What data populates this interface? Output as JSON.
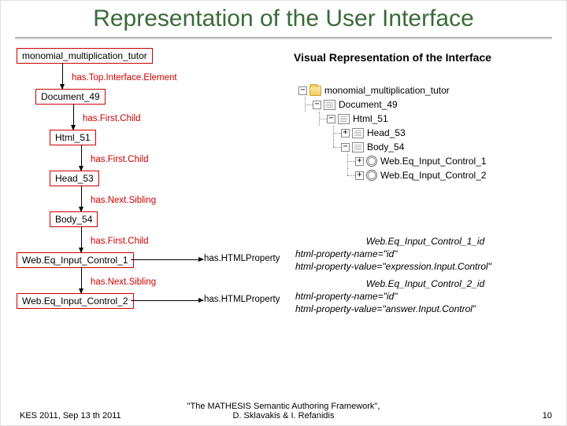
{
  "title": "Representation of the User Interface",
  "section_heading": "Visual Representation of the Interface",
  "graph": {
    "root": "monomial_multiplication_tutor",
    "e1": "has.Top.Interface.Element",
    "n1": "Document_49",
    "e2": "has.First.Child",
    "n2": "Html_51",
    "e3": "has.First.Child",
    "n3": "Head_53",
    "e4": "has.Next.Sibling",
    "n4": "Body_54",
    "e5": "has.First.Child",
    "n5": "Web.Eq_Input_Control_1",
    "e6": "has.Next.Sibling",
    "n6": "Web.Eq_Input_Control_2",
    "eh": "has.HTMLProperty"
  },
  "tree": {
    "t1": "monomial_multiplication_tutor",
    "t2": "Document_49",
    "t3": "Html_51",
    "t4": "Head_53",
    "t5": "Body_54",
    "t6": "Web.Eq_Input_Control_1",
    "t7": "Web.Eq_Input_Control_2"
  },
  "prop1": {
    "title": "Web.Eq_Input_Control_1_id",
    "l2": "html-property-name=\"id\"",
    "l3": "html-property-value=\"expression.Input.Control\""
  },
  "prop2": {
    "title": "Web.Eq_Input_Control_2_id",
    "l2": "html-property-name=\"id\"",
    "l3": "html-property-value=\"answer.Input.Control\""
  },
  "footer": {
    "left": "KES 2011, Sep 13 th 2011",
    "center1": "\"The MATHESIS Semantic Authoring Framework\",",
    "center2": "D. Sklavakis & I. Refanidis",
    "right": "10"
  }
}
